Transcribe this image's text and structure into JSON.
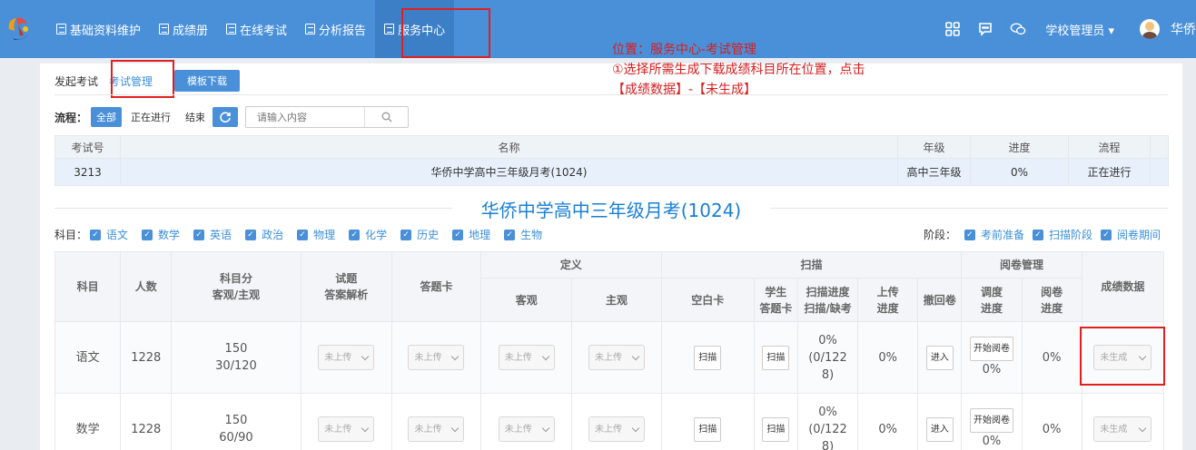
{
  "nav": {
    "items": [
      {
        "label": "基础资料维护"
      },
      {
        "label": "成绩册"
      },
      {
        "label": "在线考试"
      },
      {
        "label": "分析报告"
      },
      {
        "label": "服务中心",
        "active": true
      }
    ],
    "role": "学校管理员",
    "user": "华侨"
  },
  "tabs": {
    "launch": "发起考试",
    "manage": "考试管理",
    "template_btn": "模板下载"
  },
  "flow": {
    "label": "流程：",
    "all": "全部",
    "running": "正在进行",
    "ended": "结束",
    "search_placeholder": "请输入内容"
  },
  "annotation": {
    "line1": "位置：服务中心-考试管理",
    "line2": "①选择所需生成下载成绩科目所在位置，点击",
    "line3": "【成绩数据】-【未生成】"
  },
  "exam_table": {
    "headers": [
      "考试号",
      "名称",
      "年级",
      "进度",
      "流程"
    ],
    "row": {
      "id": "3213",
      "name": "华侨中学高中三年级月考(1024)",
      "grade": "高中三年级",
      "progress": "0%",
      "status": "正在进行"
    }
  },
  "exam_title": "华侨中学高中三年级月考(1024)",
  "subjects_filter": {
    "label": "科目：",
    "items": [
      "语文",
      "数学",
      "英语",
      "政治",
      "物理",
      "化学",
      "历史",
      "地理",
      "生物"
    ]
  },
  "stages_filter": {
    "label": "阶段：",
    "items": [
      "考前准备",
      "扫描阶段",
      "阅卷期间"
    ]
  },
  "subject_table": {
    "h_subject": "科目",
    "h_count": "人数",
    "h_score1": "科目分",
    "h_score2": "客观/主观",
    "h_exam1": "试题",
    "h_exam2": "答案解析",
    "h_card": "答题卡",
    "h_define": "定义",
    "h_objective": "客观",
    "h_subjective": "主观",
    "h_scan": "扫描",
    "h_blank": "空白卡",
    "h_student1": "学生",
    "h_student2": "答题卡",
    "h_scanprog1": "扫描进度",
    "h_scanprog2": "扫描/缺考",
    "h_upload1": "上传",
    "h_upload2": "进度",
    "h_withdraw": "撤回卷",
    "h_marking": "阅卷管理",
    "h_dispatch1": "调度",
    "h_dispatch2": "进度",
    "h_markprog1": "阅卷",
    "h_markprog2": "进度",
    "h_grade": "成绩数据",
    "rows": [
      {
        "subject": "语文",
        "count": "1228",
        "score": "150",
        "split": "30/120",
        "exam": "未上传",
        "card": "未上传",
        "obj": "未上传",
        "subj": "未上传",
        "blank": "扫描",
        "student": "扫描",
        "scan_a": "0%",
        "scan_b": "(0/122",
        "scan_c": "8)",
        "upload": "0%",
        "withdraw": "进入",
        "dispatch": "开始阅卷",
        "dispatch_pct": "0%",
        "markprog": "0%",
        "grade": "未生成"
      },
      {
        "subject": "数学",
        "count": "1228",
        "score": "150",
        "split": "60/90",
        "exam": "未上传",
        "card": "未上传",
        "obj": "未上传",
        "subj": "未上传",
        "blank": "扫描",
        "student": "扫描",
        "scan_a": "0%",
        "scan_b": "(0/122",
        "scan_c": "8)",
        "upload": "0%",
        "withdraw": "进入",
        "dispatch": "开始阅卷",
        "dispatch_pct": "0%",
        "markprog": "0%",
        "grade": "未生成"
      }
    ]
  },
  "colors": {
    "topbar": "#4a90d9",
    "accent": "#1a7fd4",
    "annotation": "#d81e1e",
    "highlight_box": "#e02020"
  }
}
